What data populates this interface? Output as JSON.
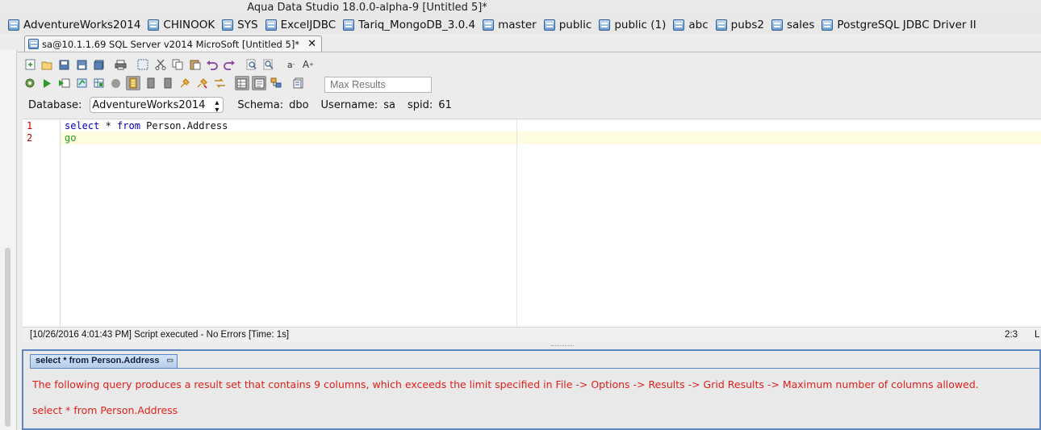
{
  "window": {
    "title": "Aqua Data Studio 18.0.0-alpha-9 [Untitled 5]*"
  },
  "bookmarks": [
    "AdventureWorks2014",
    "CHINOOK",
    "SYS",
    "ExcelJDBC",
    "Tariq_MongoDB_3.0.4",
    "master",
    "public",
    "public (1)",
    "abc",
    "pubs2",
    "sales",
    "PostgreSQL JDBC Driver II"
  ],
  "tab": {
    "label": "sa@10.1.1.69 SQL Server v2014 MicroSoft [Untitled 5]*",
    "close": "✕",
    "icon": "database-icon"
  },
  "toolbar": {
    "max_results_placeholder": "Max Results",
    "font_small": "a",
    "font_large": "A"
  },
  "connection": {
    "database_label": "Database:",
    "database_value": "AdventureWorks2014",
    "schema_label": "Schema:",
    "schema_value": "dbo",
    "username_label": "Username:",
    "username_value": "sa",
    "spid_label": "spid:",
    "spid_value": "61"
  },
  "editor": {
    "lines": [
      {
        "num": "1",
        "kw": "select",
        "op": " * ",
        "kw2": "from",
        "rest": " Person.Address"
      },
      {
        "num": "2",
        "go": "go"
      }
    ]
  },
  "status": {
    "message": "[10/26/2016 4:01:43 PM] Script executed - No Errors [Time: 1s]",
    "position": "2:3",
    "mode": "L"
  },
  "results": {
    "tab_label": "select * from Person.Address",
    "error_message": "The following query produces a result set that contains 9 columns, which exceeds the limit specified in File -> Options -> Results -> Grid Results -> Maximum number of columns allowed.",
    "query": "select * from Person.Address"
  },
  "colors": {
    "error": "#e0201c",
    "keyword": "#0000c0",
    "go_keyword": "#1f9a1f",
    "line_number": "#c00000",
    "results_border": "#5a86c2"
  }
}
